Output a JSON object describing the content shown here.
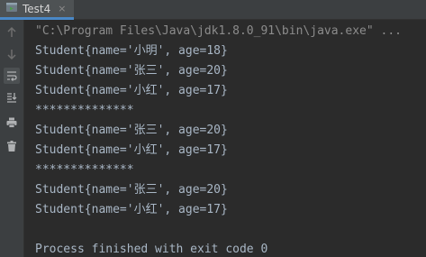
{
  "tab": {
    "title": "Test4",
    "close_glyph": "×"
  },
  "toolbar": {
    "buttons": [
      {
        "name": "scroll-up",
        "icon": "arrow-up-icon"
      },
      {
        "name": "scroll-down",
        "icon": "arrow-down-icon"
      },
      {
        "name": "soft-wrap",
        "icon": "soft-wrap-icon"
      },
      {
        "name": "scroll-to-end",
        "icon": "scroll-to-end-icon"
      },
      {
        "name": "print",
        "icon": "printer-icon"
      },
      {
        "name": "clear-all",
        "icon": "trash-icon"
      }
    ]
  },
  "console": {
    "command": "\"C:\\Program Files\\Java\\jdk1.8.0_91\\bin\\java.exe\" ...",
    "lines": [
      "Student{name='小明', age=18}",
      "Student{name='张三', age=20}",
      "Student{name='小红', age=17}",
      "**************",
      "Student{name='张三', age=20}",
      "Student{name='小红', age=17}",
      "**************",
      "Student{name='张三', age=20}",
      "Student{name='小红', age=17}",
      "",
      "Process finished with exit code 0"
    ]
  },
  "colors": {
    "background": "#2b2b2b",
    "toolbar": "#3c3f41",
    "text": "#a9b7c6",
    "command_text": "#8c8c8c",
    "tab_accent": "#4a88c7"
  }
}
